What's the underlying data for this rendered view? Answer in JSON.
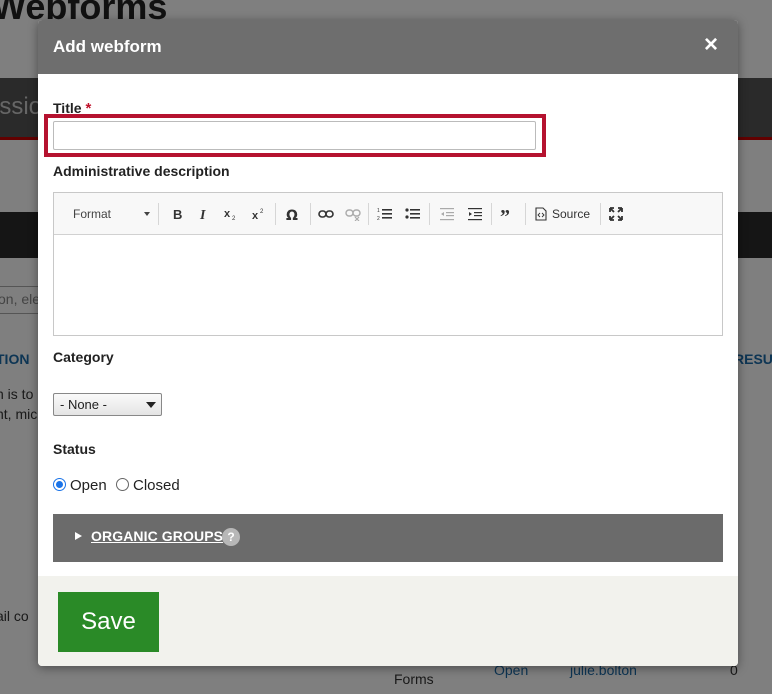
{
  "background": {
    "page_title": "Webforms",
    "band_text": "issio",
    "search_text": "on, ele",
    "col_left": "TION",
    "col_right": "RESUL",
    "row1": "h is to",
    "row2": "nt, mic",
    "row3": "ail co",
    "forms_text": "Forms",
    "link_open": "Open",
    "link_user": "julie.bolton",
    "count": "0"
  },
  "dialog": {
    "title": "Add webform",
    "close_label": "×",
    "title_field": {
      "label": "Title",
      "required_mark": "*",
      "value": ""
    },
    "description": {
      "label": "Administrative description",
      "toolbar": {
        "format_label": "Format",
        "source_label": "Source",
        "icons": [
          "bold-icon",
          "italic-icon",
          "subscript-icon",
          "superscript-icon",
          "special-char-icon",
          "link-icon",
          "unlink-icon",
          "numbered-list-icon",
          "bulleted-list-icon",
          "outdent-icon",
          "indent-icon",
          "blockquote-icon",
          "source-icon",
          "maximize-icon"
        ]
      }
    },
    "category": {
      "label": "Category",
      "selected": "- None -"
    },
    "status": {
      "label": "Status",
      "options": [
        {
          "label": "Open",
          "checked": true
        },
        {
          "label": "Closed",
          "checked": false
        }
      ]
    },
    "organic_groups": {
      "label": "ORGANIC GROUPS",
      "help": "?"
    },
    "save_label": "Save"
  },
  "colors": {
    "header": "#6e6e6e",
    "highlight": "#b5122f",
    "save": "#2a8a27",
    "organic_groups_bg": "#6b6b6b"
  }
}
